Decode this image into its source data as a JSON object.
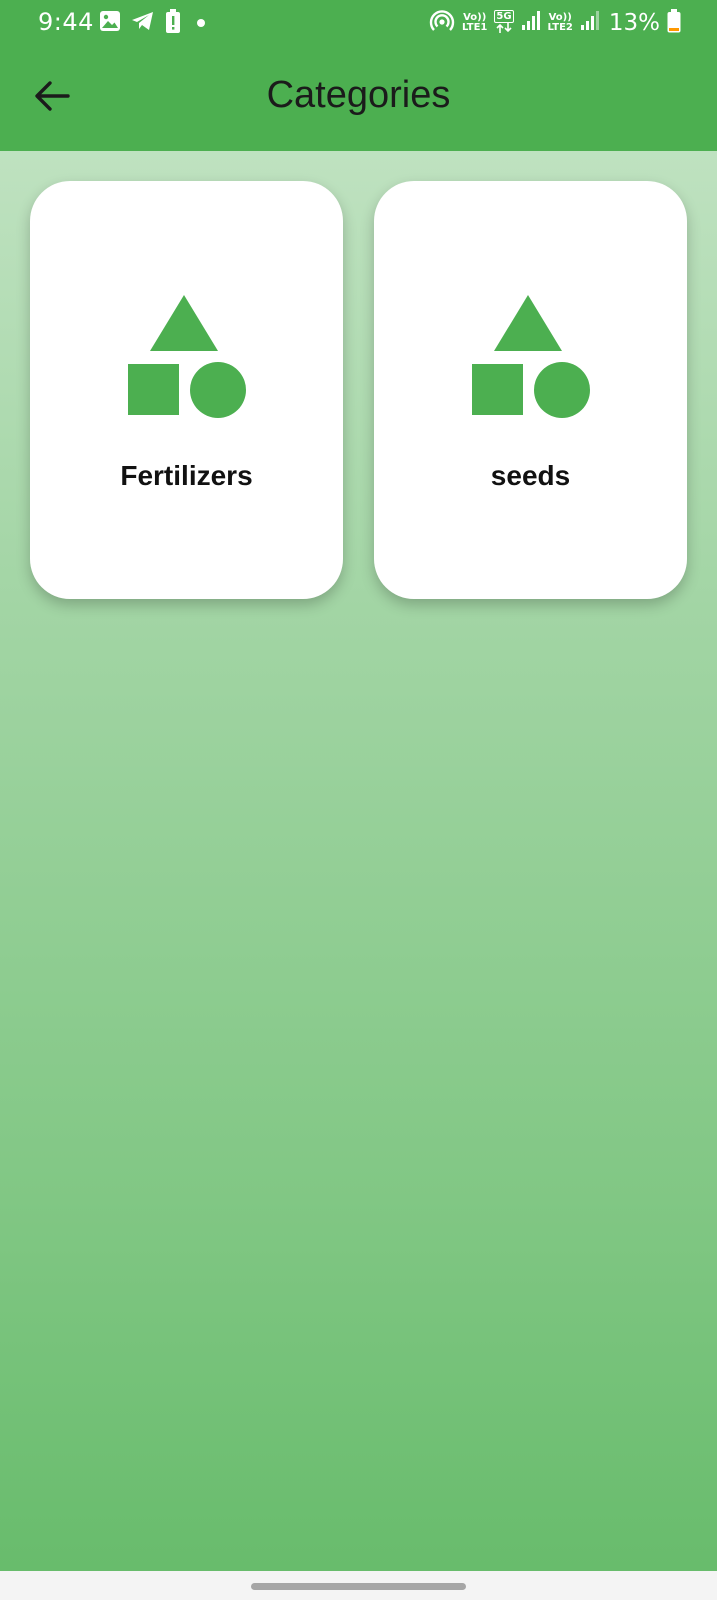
{
  "status_bar": {
    "time": "9:44",
    "left_icons": [
      "gallery-icon",
      "telegram-icon",
      "battery-alert-icon",
      "dot-icon"
    ],
    "right_icons": [
      "hotspot-icon",
      "signal-icon",
      "battery-icon"
    ],
    "volte1_top": "Vo))",
    "volte1_bottom": "LTE1",
    "network_5g": "5G",
    "volte2_top": "Vo))",
    "volte2_bottom": "LTE2",
    "battery": "13%"
  },
  "app_bar": {
    "title": "Categories",
    "back_icon": "arrow-back-icon"
  },
  "categories": [
    {
      "label": "Fertilizers",
      "icon": "category-shapes-icon"
    },
    {
      "label": "seeds",
      "icon": "category-shapes-icon"
    }
  ],
  "colors": {
    "primary": "#4caf50",
    "background_top": "#c8e6c9",
    "background_bottom": "#66bb6a",
    "card": "#ffffff",
    "icon_green": "#4caf50",
    "title_text": "#1b1b1b"
  }
}
